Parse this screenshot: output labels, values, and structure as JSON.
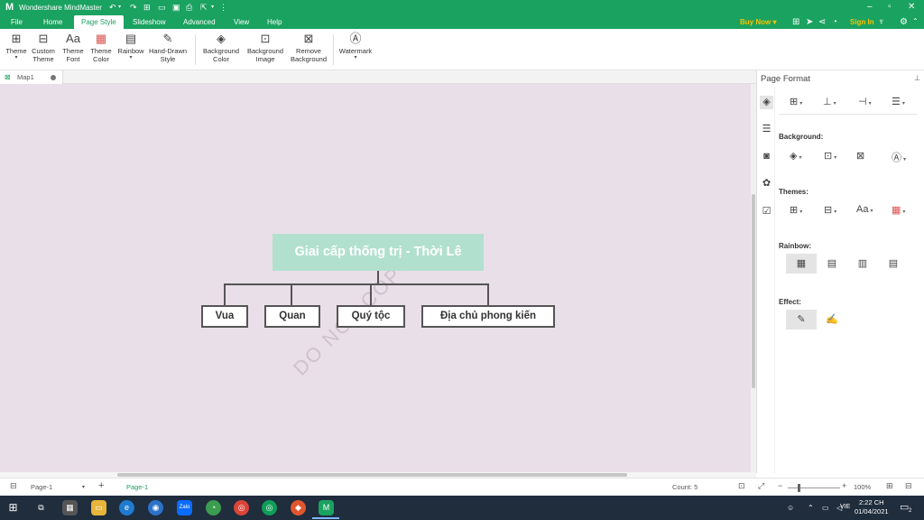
{
  "app": {
    "title": "Wondershare MindMaster",
    "logo": "M"
  },
  "menu": {
    "tabs": [
      "File",
      "Home",
      "Page Style",
      "Slideshow",
      "Advanced",
      "View",
      "Help"
    ],
    "active": "Page Style",
    "buy_now": "Buy Now ▾",
    "sign_in": "Sign In"
  },
  "ribbon": {
    "theme": [
      "Theme",
      ""
    ],
    "custom_theme": [
      "Custom",
      "Theme"
    ],
    "theme_font": [
      "Theme",
      "Font"
    ],
    "theme_color": [
      "Theme",
      "Color"
    ],
    "rainbow": [
      "Rainbow",
      ""
    ],
    "hand_drawn": [
      "Hand-Drawn",
      "Style"
    ],
    "bg_color": [
      "Background",
      "Color"
    ],
    "bg_image": [
      "Background",
      "Image"
    ],
    "remove_bg": [
      "Remove",
      "Background"
    ],
    "watermark": [
      "Watermark",
      ""
    ]
  },
  "doc": {
    "tab_label": "Map1"
  },
  "map": {
    "root": "Giai cấp thống trị - Thời Lê",
    "children": [
      "Vua",
      "Quan",
      "Quý tộc",
      "Địa chủ phong kiến"
    ],
    "watermark": "DO NOT COPY",
    "root_color": "#b2e0cf",
    "canvas_color": "#e9dfe8"
  },
  "panel": {
    "title": "Page Format",
    "background_label": "Background:",
    "themes_label": "Themes:",
    "rainbow_label": "Rainbow:",
    "effect_label": "Effect:"
  },
  "status": {
    "page_select": "Page-1",
    "page_tab": "Page-1",
    "count": "Count: 5",
    "zoom": "100%"
  },
  "taskbar": {
    "lang": "VIE",
    "time": "2:22 CH",
    "date": "01/04/2021",
    "notifications": "2"
  },
  "colors": {
    "accent": "#1aa260",
    "highlight": "#f5c400"
  }
}
